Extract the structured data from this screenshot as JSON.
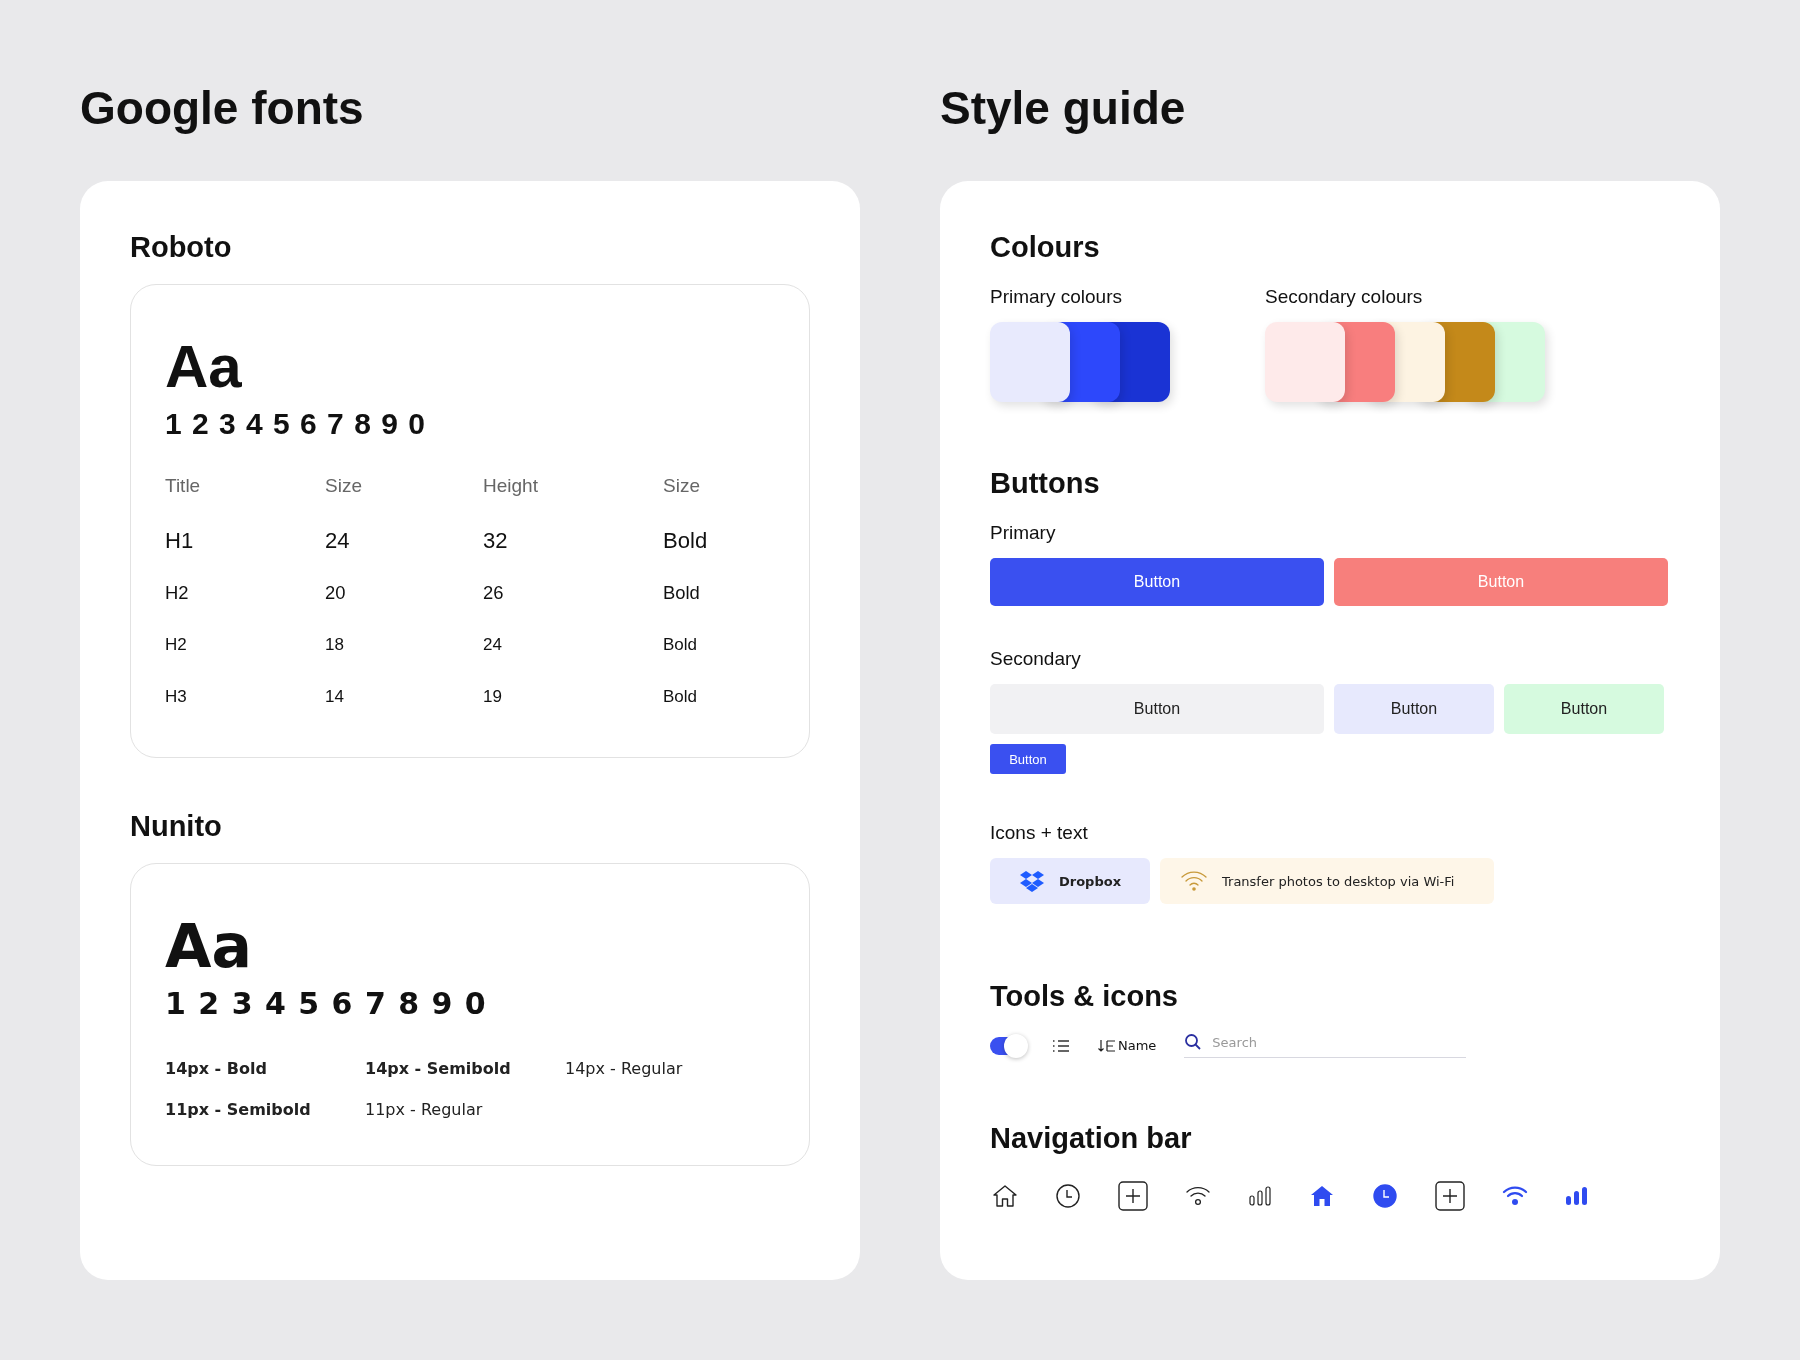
{
  "left": {
    "title": "Google fonts",
    "roboto": {
      "name": "Roboto",
      "sample": "Aa",
      "digits": "1 2 3 4 5 6 7 8 9 0",
      "columns": [
        "Title",
        "Size",
        "Height",
        "Size"
      ],
      "rows": [
        [
          "H1",
          "24",
          "32",
          "Bold"
        ],
        [
          "H2",
          "20",
          "26",
          "Bold"
        ],
        [
          "H2",
          "18",
          "24",
          "Bold"
        ],
        [
          "H3",
          "14",
          "19",
          "Bold"
        ]
      ]
    },
    "nunito": {
      "name": "Nunito",
      "sample": "Aa",
      "digits": "1 2 3 4 5 6 7 8 9 0",
      "samples": [
        {
          "text": "14px - Bold",
          "kind": "bold"
        },
        {
          "text": "14px - Semibold",
          "kind": "semibold"
        },
        {
          "text": "14px - Regular",
          "kind": "regular"
        },
        {
          "text": "11px - Semibold",
          "kind": "semibold"
        },
        {
          "text": "11px - Regular",
          "kind": "regular"
        }
      ]
    }
  },
  "right": {
    "title": "Style guide",
    "colours": {
      "heading": "Colours",
      "groups": [
        {
          "label": "Primary colours",
          "swatches": [
            {
              "color": "#e8eafd"
            },
            {
              "color": "#2d48fb"
            },
            {
              "color": "#1a33d4"
            }
          ]
        },
        {
          "label": "Secondary colours",
          "swatches": [
            {
              "color": "#feeaea"
            },
            {
              "color": "#f87e7e"
            },
            {
              "color": "#fdf3e2"
            },
            {
              "color": "#c4891a"
            },
            {
              "color": "#d6fadf"
            }
          ]
        }
      ]
    },
    "buttons": {
      "heading": "Buttons",
      "primary_label": "Primary",
      "primary": [
        {
          "label": "Button",
          "color": "#3a50f0"
        },
        {
          "label": "Button",
          "color": "#f77f7c"
        }
      ],
      "secondary_label": "Secondary",
      "secondary": [
        {
          "label": "Button",
          "color": "#f1f1f3",
          "kind": "wide"
        },
        {
          "label": "Button",
          "color": "#e7e9fd",
          "kind": "narrow"
        },
        {
          "label": "Button",
          "color": "#d6fadf",
          "kind": "narrow"
        },
        {
          "label": "Button",
          "color": "#3a50f0",
          "kind": "small"
        }
      ],
      "icons_label": "Icons + text",
      "chips": [
        {
          "label": "Dropbox",
          "kind": "dropbox",
          "color": "#e7e9fd"
        },
        {
          "label": "Transfer photos to desktop via Wi-Fi",
          "kind": "wifi",
          "color": "#fef6e8"
        }
      ]
    },
    "tools": {
      "heading": "Tools & icons",
      "toggle": {
        "on": true
      },
      "sort_label": "Name",
      "search": {
        "placeholder": "Search"
      }
    },
    "nav": {
      "heading": "Navigation bar",
      "items": [
        {
          "kind": "home",
          "selected": false
        },
        {
          "kind": "clock",
          "selected": false
        },
        {
          "kind": "plus"
        },
        {
          "kind": "wifi",
          "selected": false
        },
        {
          "kind": "signal",
          "selected": false
        },
        {
          "kind": "home",
          "selected": true
        },
        {
          "kind": "clock",
          "selected": true
        },
        {
          "kind": "plus"
        },
        {
          "kind": "wifi",
          "selected": true
        },
        {
          "kind": "signal",
          "selected": true
        }
      ]
    }
  }
}
